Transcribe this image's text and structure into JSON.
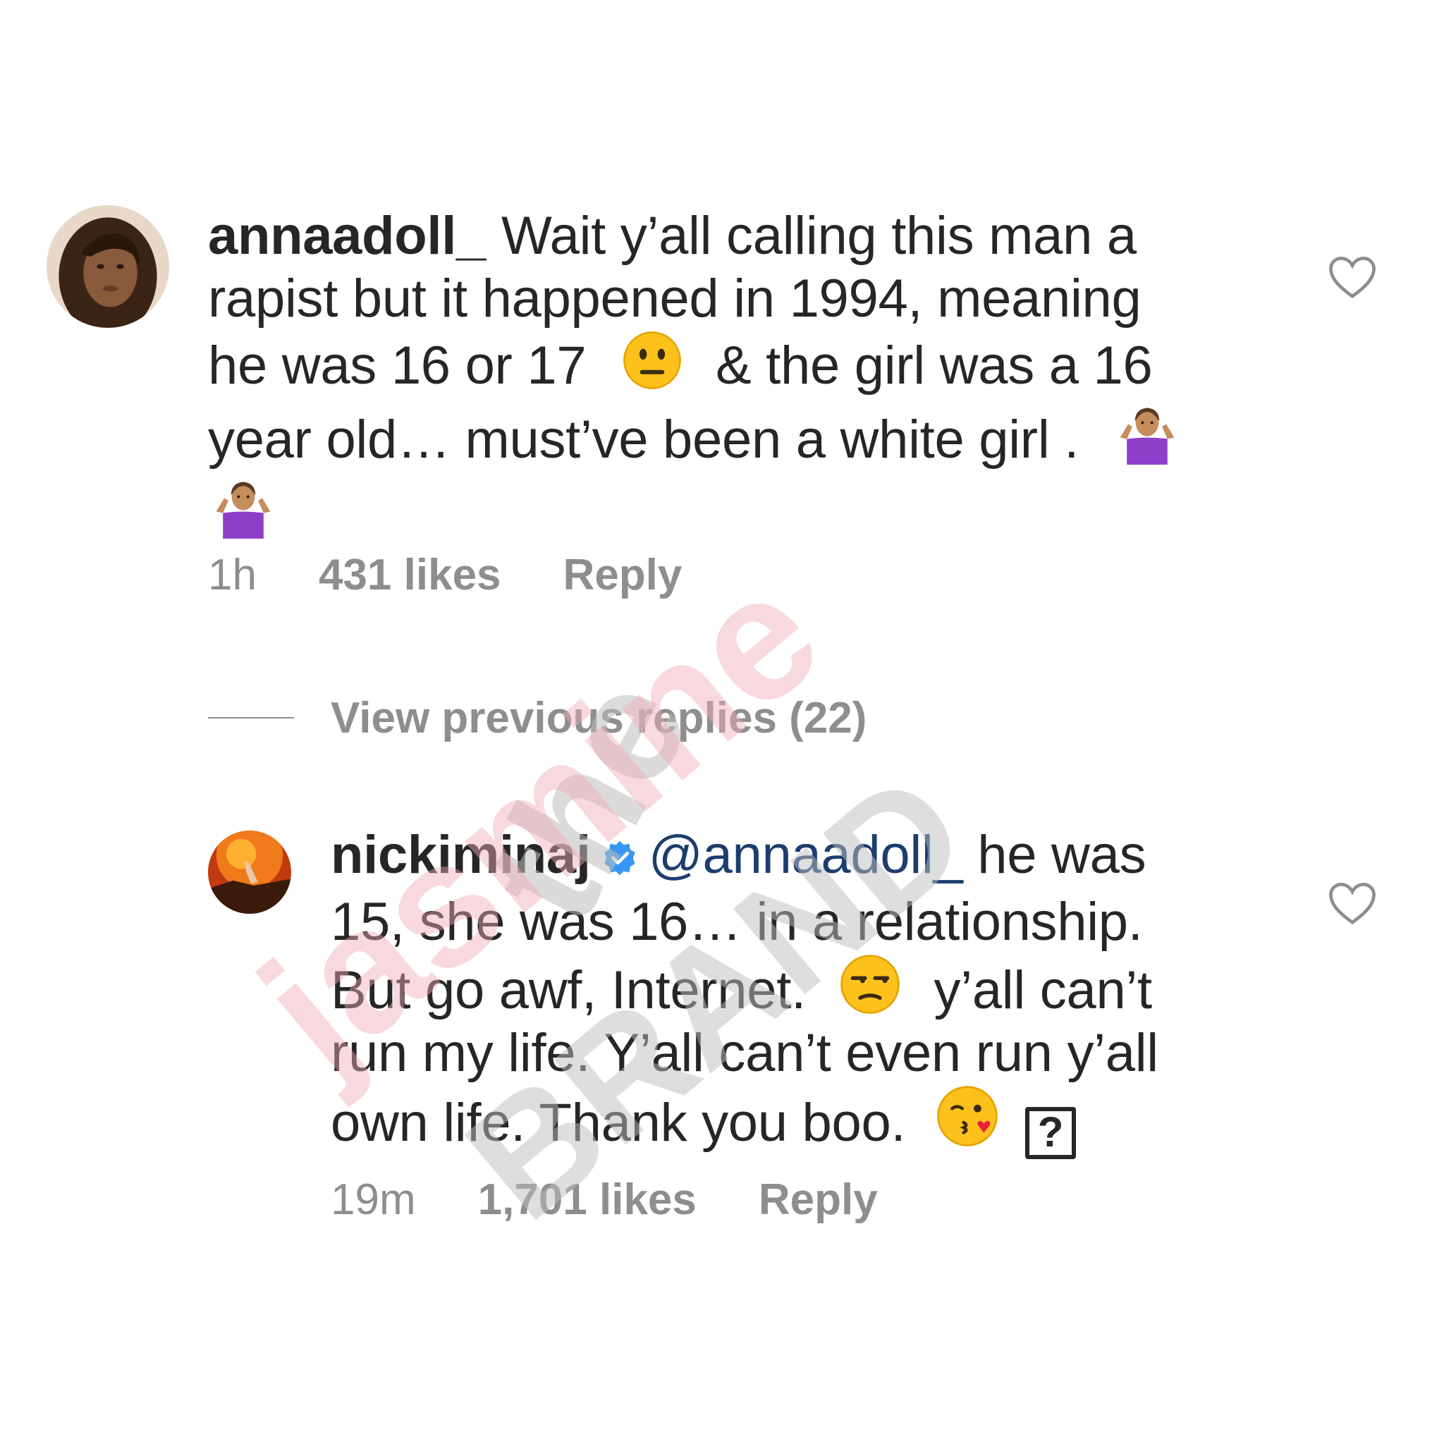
{
  "comments": [
    {
      "username": "annaadoll_",
      "text_line1": "Wait y’all calling this man a",
      "text_line2": "rapist but it happened in 1994, meaning",
      "text_line3a": "he was 16 or 17",
      "text_line3b": "& the girl was a 16",
      "text_line4": "year old… must’ve been a white girl .",
      "time": "1h",
      "likes": "431 likes",
      "reply": "Reply",
      "avatar_icon": "profile-photo"
    },
    {
      "username": "nickiminaj",
      "mention": "@annaadoll_",
      "text_line1_rest": "he was",
      "text_line2": "15, she was 16… in a relationship.",
      "text_line3a": "But go awf, Internet.",
      "text_line3b": "y’all can’t",
      "text_line4": "run my life. Y’all can’t even run y’all",
      "text_line5": "own life. Thank you boo.",
      "unknown_glyph": "?",
      "time": "19m",
      "likes": "1,701 likes",
      "reply": "Reply",
      "avatar_icon": "profile-photo"
    }
  ],
  "view_previous_replies": "View previous replies (22)",
  "watermark": {
    "line1": "the",
    "line2": "jasmine",
    "line3": "BRAND"
  },
  "colors": {
    "text": "#262626",
    "muted": "#8e8e8e",
    "mention": "#1c3d6e",
    "verified": "#3897f0",
    "watermark_pink": "#f4c6cc",
    "watermark_gray": "#d6d6d6"
  }
}
